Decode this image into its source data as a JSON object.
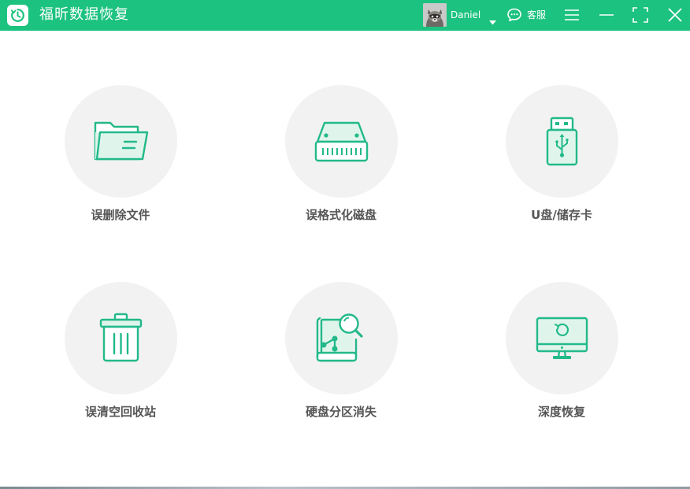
{
  "app": {
    "title": "福昕数据恢复",
    "accent_color": "#1cc27f"
  },
  "header": {
    "username": "Daniel",
    "support_label": "客服",
    "icons": {
      "logo": "clock-refresh-icon",
      "avatar": "raccoon-avatar",
      "dropdown": "caret-down-icon",
      "support": "chat-bubble-icon",
      "menu": "hamburger-menu-icon",
      "minimize": "minimize-icon",
      "maximize": "maximize-icon",
      "close": "close-icon"
    }
  },
  "modes": [
    {
      "label": "误删除文件",
      "icon": "folder-icon"
    },
    {
      "label": "误格式化磁盘",
      "icon": "hard-disk-icon"
    },
    {
      "label": "U盘/储存卡",
      "icon": "usb-drive-icon"
    },
    {
      "label": "误清空回收站",
      "icon": "trash-bin-icon"
    },
    {
      "label": "硬盘分区消失",
      "icon": "disk-search-icon"
    },
    {
      "label": "深度恢复",
      "icon": "monitor-restore-icon"
    }
  ]
}
